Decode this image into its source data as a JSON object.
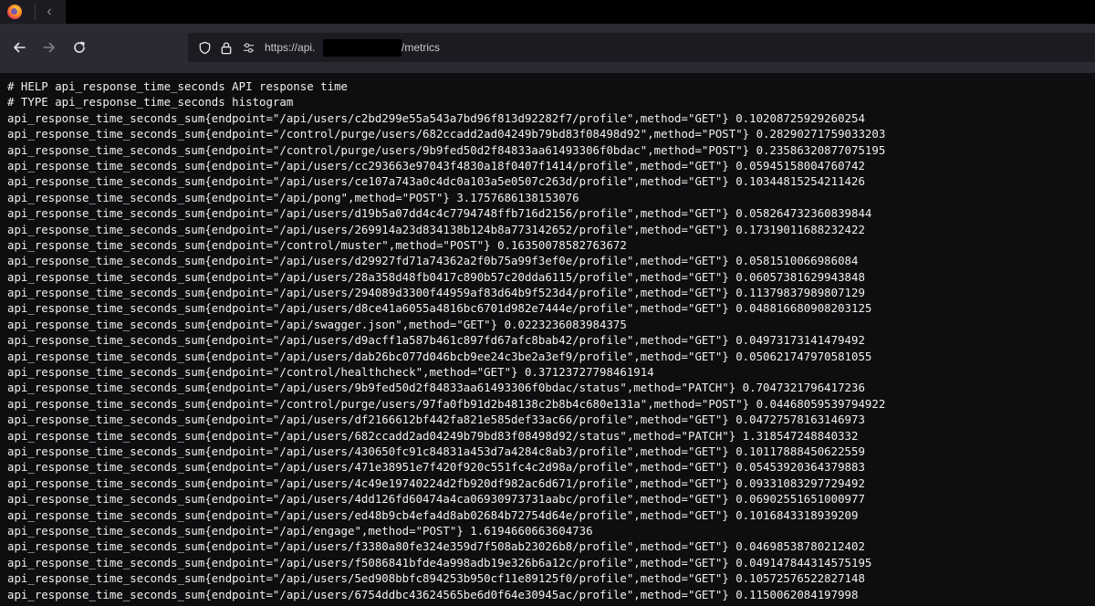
{
  "browser": {
    "url_prefix": "https://api.",
    "url_suffix": "/metrics"
  },
  "metrics_lines": [
    "# HELP api_response_time_seconds API response time",
    "# TYPE api_response_time_seconds histogram",
    "api_response_time_seconds_sum{endpoint=\"/api/users/c2bd299e55a543a7bd96f813d92282f7/profile\",method=\"GET\"} 0.10208725929260254",
    "api_response_time_seconds_sum{endpoint=\"/control/purge/users/682ccadd2ad04249b79bd83f08498d92\",method=\"POST\"} 0.28290271759033203",
    "api_response_time_seconds_sum{endpoint=\"/control/purge/users/9b9fed50d2f84833aa61493306f0bdac\",method=\"POST\"} 0.23586320877075195",
    "api_response_time_seconds_sum{endpoint=\"/api/users/cc293663e97043f4830a18f0407f1414/profile\",method=\"GET\"} 0.05945158004760742",
    "api_response_time_seconds_sum{endpoint=\"/api/users/ce107a743a0c4dc0a103a5e0507c263d/profile\",method=\"GET\"} 0.10344815254211426",
    "api_response_time_seconds_sum{endpoint=\"/api/pong\",method=\"POST\"} 3.1757686138153076",
    "api_response_time_seconds_sum{endpoint=\"/api/users/d19b5a07dd4c4c7794748ffb716d2156/profile\",method=\"GET\"} 0.058264732360839844",
    "api_response_time_seconds_sum{endpoint=\"/api/users/269914a23d834138b124b8a773142652/profile\",method=\"GET\"} 0.17319011688232422",
    "api_response_time_seconds_sum{endpoint=\"/control/muster\",method=\"POST\"} 0.16350078582763672",
    "api_response_time_seconds_sum{endpoint=\"/api/users/d29927fd71a74362a2f0b75a99f3ef0e/profile\",method=\"GET\"} 0.0581510066986084",
    "api_response_time_seconds_sum{endpoint=\"/api/users/28a358d48fb0417c890b57c20dda6115/profile\",method=\"GET\"} 0.06057381629943848",
    "api_response_time_seconds_sum{endpoint=\"/api/users/294089d3300f44959af83d64b9f523d4/profile\",method=\"GET\"} 0.11379837989807129",
    "api_response_time_seconds_sum{endpoint=\"/api/users/d8ce41a6055a4816bc6701d982e7444e/profile\",method=\"GET\"} 0.048816680908203125",
    "api_response_time_seconds_sum{endpoint=\"/api/swagger.json\",method=\"GET\"} 0.0223236083984375",
    "api_response_time_seconds_sum{endpoint=\"/api/users/d9acff1a587b461c897fd67afc8bab42/profile\",method=\"GET\"} 0.04973173141479492",
    "api_response_time_seconds_sum{endpoint=\"/api/users/dab26bc077d046bcb9ee24c3be2a3ef9/profile\",method=\"GET\"} 0.050621747970581055",
    "api_response_time_seconds_sum{endpoint=\"/control/healthcheck\",method=\"GET\"} 0.37123727798461914",
    "api_response_time_seconds_sum{endpoint=\"/api/users/9b9fed50d2f84833aa61493306f0bdac/status\",method=\"PATCH\"} 0.7047321796417236",
    "api_response_time_seconds_sum{endpoint=\"/control/purge/users/97fa0fb91d2b48138c2b8b4c680e131a\",method=\"POST\"} 0.04468059539794922",
    "api_response_time_seconds_sum{endpoint=\"/api/users/df2166612bf442fa821e585def33ac66/profile\",method=\"GET\"} 0.04727578163146973",
    "api_response_time_seconds_sum{endpoint=\"/api/users/682ccadd2ad04249b79bd83f08498d92/status\",method=\"PATCH\"} 1.318547248840332",
    "api_response_time_seconds_sum{endpoint=\"/api/users/430650fc91c84831a453d7a4284c8ab3/profile\",method=\"GET\"} 0.10117888450622559",
    "api_response_time_seconds_sum{endpoint=\"/api/users/471e38951e7f420f920c551fc4c2d98a/profile\",method=\"GET\"} 0.05453920364379883",
    "api_response_time_seconds_sum{endpoint=\"/api/users/4c49e19740224d2fb920df982ac6d671/profile\",method=\"GET\"} 0.09331083297729492",
    "api_response_time_seconds_sum{endpoint=\"/api/users/4dd126fd60474a4ca06930973731aabc/profile\",method=\"GET\"} 0.06902551651000977",
    "api_response_time_seconds_sum{endpoint=\"/api/users/ed48b9cb4efa4d8ab02684b72754d64e/profile\",method=\"GET\"} 0.1016843318939209",
    "api_response_time_seconds_sum{endpoint=\"/api/engage\",method=\"POST\"} 1.6194660663604736",
    "api_response_time_seconds_sum{endpoint=\"/api/users/f3380a80fe324e359d7f508ab23026b8/profile\",method=\"GET\"} 0.04698538780212402",
    "api_response_time_seconds_sum{endpoint=\"/api/users/f5086841bfde4a998adb19e326b6a12c/profile\",method=\"GET\"} 0.049147844314575195",
    "api_response_time_seconds_sum{endpoint=\"/api/users/5ed908bbfc894253b950cf11e89125f0/profile\",method=\"GET\"} 0.10572576522827148",
    "api_response_time_seconds_sum{endpoint=\"/api/users/6754ddbc43624565be6d0f64e30945ac/profile\",method=\"GET\"} 0.1150062084197998"
  ]
}
